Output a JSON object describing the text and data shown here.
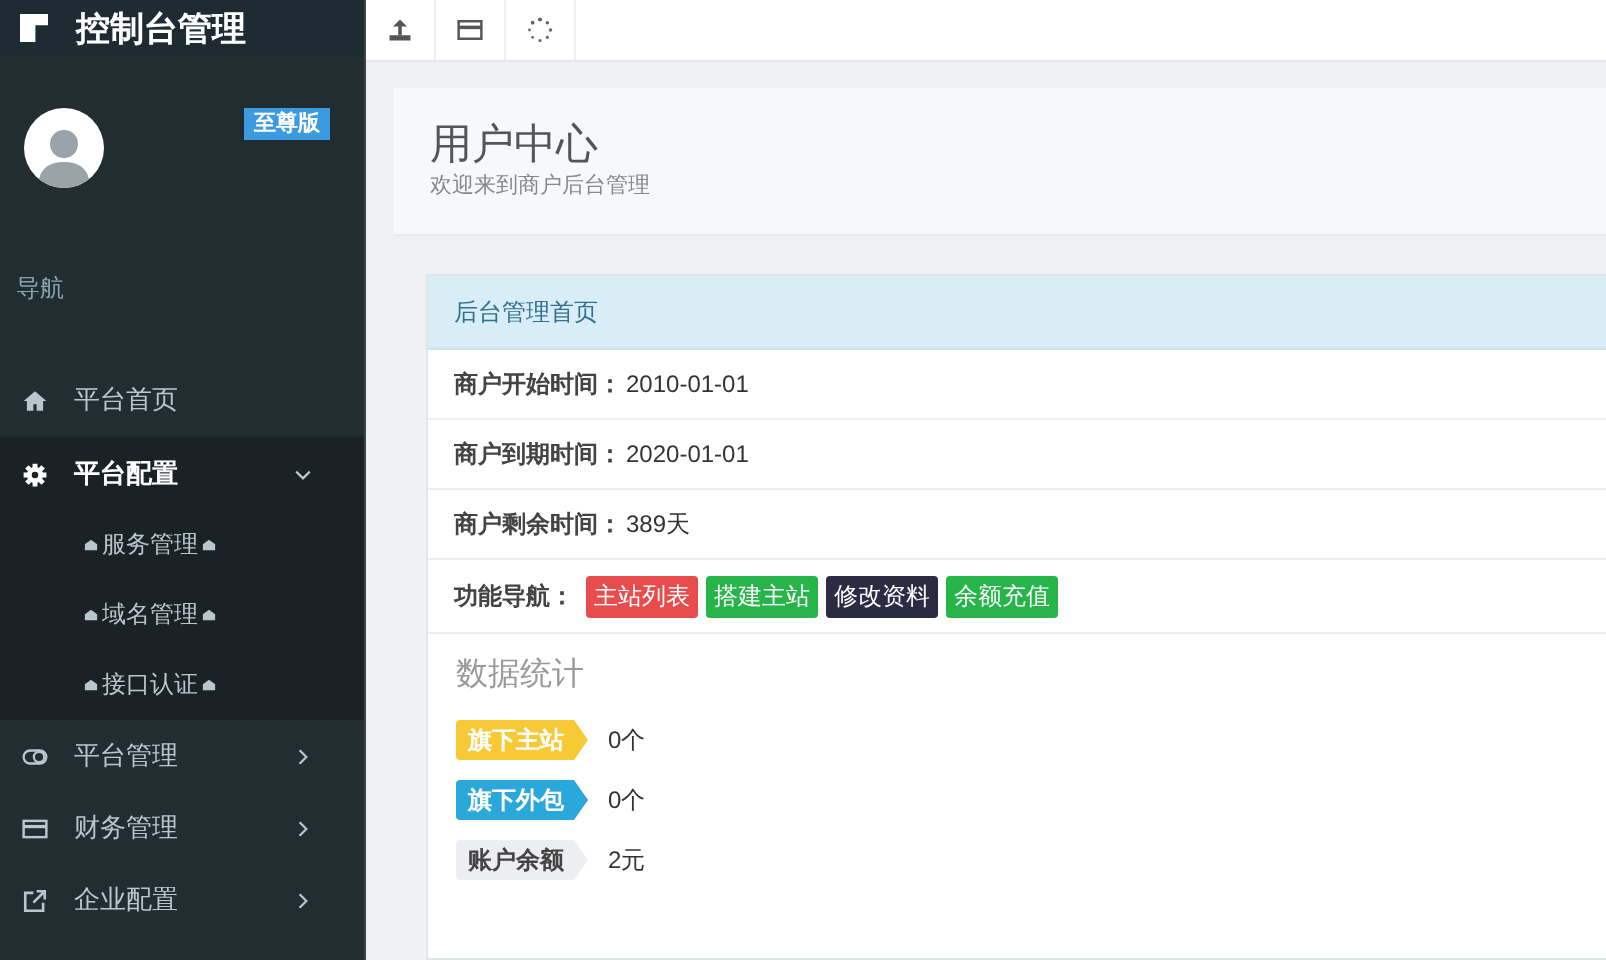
{
  "brand": {
    "title": "控制台管理"
  },
  "user": {
    "badge": "至尊版"
  },
  "nav_header": "导航",
  "menu": [
    {
      "label": "平台首页",
      "kind": "link",
      "expanded": false
    },
    {
      "label": "平台配置",
      "kind": "group",
      "expanded": true,
      "children": [
        {
          "label": "服务管理"
        },
        {
          "label": "域名管理"
        },
        {
          "label": "接口认证"
        }
      ]
    },
    {
      "label": "平台管理",
      "kind": "group",
      "expanded": false
    },
    {
      "label": "财务管理",
      "kind": "group",
      "expanded": false
    },
    {
      "label": "企业配置",
      "kind": "group",
      "expanded": false
    }
  ],
  "page_header": {
    "title": "用户中心",
    "subtitle": "欢迎来到商户后台管理"
  },
  "panel": {
    "heading": "后台管理首页",
    "info_rows": [
      {
        "label": "商户开始时间：",
        "value": "2010-01-01"
      },
      {
        "label": "商户到期时间：",
        "value": "2020-01-01"
      },
      {
        "label": "商户剩余时间：",
        "value": "389天"
      }
    ],
    "nav_label": "功能导航：",
    "nav_buttons": [
      {
        "label": "主站列表",
        "color": "#e84c4c"
      },
      {
        "label": "搭建主站",
        "color": "#27b54a"
      },
      {
        "label": "修改资料",
        "color": "#2b2c44"
      },
      {
        "label": "余额充值",
        "color": "#27b54a"
      }
    ],
    "stats_title": "数据统计",
    "stats": [
      {
        "label": "旗下主站",
        "value": "0个",
        "color": "#f6c935"
      },
      {
        "label": "旗下外包",
        "value": "0个",
        "color": "#2aa8dc"
      },
      {
        "label": "账户余额",
        "value": "2元",
        "color": "#eceef2"
      }
    ]
  }
}
